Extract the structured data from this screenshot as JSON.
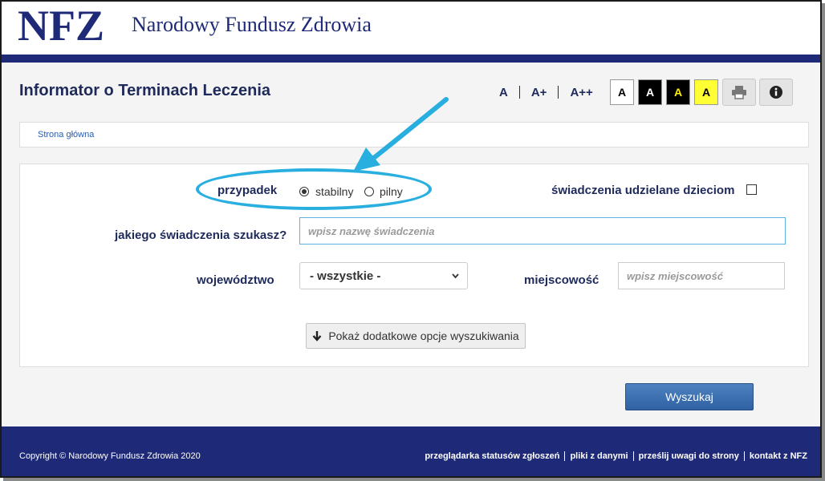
{
  "header": {
    "logo_text": "NFZ",
    "org_name": "Narodowy Fundusz Zdrowia"
  },
  "page": {
    "title": "Informator o Terminach Leczenia"
  },
  "accessibility": {
    "font_sizes": [
      "A",
      "A+",
      "A++"
    ],
    "contrast_buttons": [
      {
        "label": "A",
        "bg": "#ffffff",
        "fg": "#000000"
      },
      {
        "label": "A",
        "bg": "#000000",
        "fg": "#ffffff"
      },
      {
        "label": "A",
        "bg": "#000000",
        "fg": "#ffeb00"
      },
      {
        "label": "A",
        "bg": "#ffff33",
        "fg": "#000000"
      }
    ],
    "print_icon": "printer-icon",
    "info_icon": "info-icon"
  },
  "breadcrumb": {
    "home": "Strona główna"
  },
  "form": {
    "case_label": "przypadek",
    "case_options": [
      "stabilny",
      "pilny"
    ],
    "case_selected": "stabilny",
    "children_label": "świadczenia udzielane dzieciom",
    "children_checked": false,
    "service_label": "jakiego świadczenia szukasz?",
    "service_placeholder": "wpisz nazwę świadczenia",
    "service_value": "",
    "province_label": "województwo",
    "province_value": "- wszystkie -",
    "city_label": "miejscowość",
    "city_placeholder": "wpisz miejscowość",
    "more_options_label": "Pokaż dodatkowe opcje wyszukiwania",
    "search_label": "Wyszukaj"
  },
  "footer": {
    "copyright": "Copyright © Narodowy Fundusz Zdrowia 2020",
    "links": [
      "przeglądarka statusów zgłoszeń",
      "pliki z danymi",
      "prześlij uwagi do strony",
      "kontakt z NFZ"
    ]
  },
  "colors": {
    "brand_navy": "#1e2a78",
    "annotation_cyan": "#29aee0",
    "search_button": "#2f61a3"
  }
}
